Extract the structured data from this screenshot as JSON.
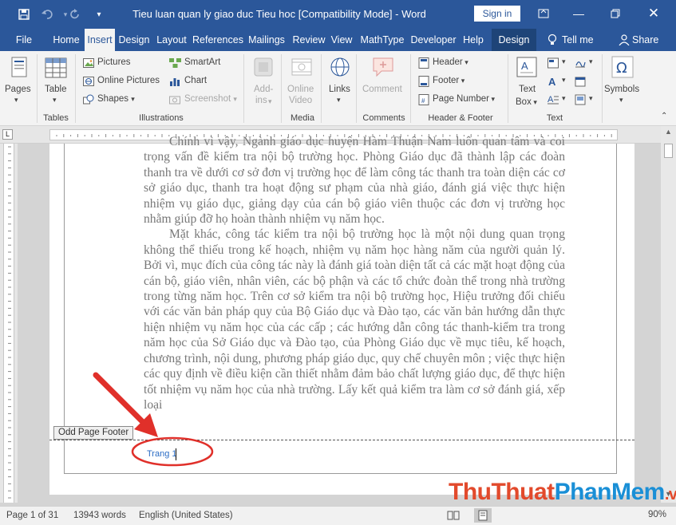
{
  "window": {
    "title": "Tieu luan quan ly giao duc Tieu hoc [Compatibility Mode]  -  Word",
    "signin_label": "Sign in"
  },
  "tabs": [
    "File",
    "Home",
    "Insert",
    "Design",
    "Layout",
    "References",
    "Mailings",
    "Review",
    "View",
    "MathType",
    "Developer",
    "Help",
    "Design"
  ],
  "tell_me": "Tell me",
  "share": "Share",
  "ribbon": {
    "pages": "Pages",
    "table": "Table",
    "pictures": "Pictures",
    "online_pictures": "Online Pictures",
    "shapes": "Shapes",
    "smartart": "SmartArt",
    "chart": "Chart",
    "screenshot": "Screenshot",
    "addins_1": "Add-",
    "addins_2": "ins",
    "online_video_1": "Online",
    "online_video_2": "Video",
    "links": "Links",
    "comment": "Comment",
    "header": "Header",
    "footer": "Footer",
    "page_number": "Page Number",
    "textbox_1": "Text",
    "textbox_2": "Box",
    "symbols": "Symbols",
    "groups": {
      "tables": "Tables",
      "illustrations": "Illustrations",
      "media": "Media",
      "comments": "Comments",
      "header_footer": "Header & Footer",
      "text": "Text"
    }
  },
  "document": {
    "paragraph1": "Chính vì vậy, Ngành giáo dục huyện Hàm Thuận Nam luôn quan tâm và coi trọng vấn đề kiểm tra nội bộ trường học. Phòng Giáo dục đã thành lập các đoàn thanh tra về dưới cơ sở đơn vị trường học để làm công tác thanh tra toàn diện các cơ sở giáo dục, thanh tra hoạt động sư phạm của nhà     giáo, đánh giá việc thực hiện nhiệm vụ giáo dục, giảng dạy của cán bộ giáo viên thuộc các đơn vị trường học nhằm giúp đỡ họ hoàn thành nhiệm vụ năm học.",
    "paragraph2": "Mặt khác, công tác kiểm tra nội bộ trường học là một nội dung quan trọng không thể thiếu trong kế hoạch, nhiệm vụ năm học hàng năm của người quản lý. Bởi vì, mục đích của công tác này là đánh giá toàn diện tất cả các mặt hoạt động của cán bộ, giáo viên, nhân viên, các bộ phận và các tổ chức đoàn thể trong nhà trường trong từng năm học. Trên cơ sở kiểm tra nội bộ trường học, Hiệu trưởng đối chiếu với các văn bản pháp quy của Bộ Giáo dục và Đào tạo, các văn bản hướng dẫn thực hiện nhiệm vụ năm học của các cấp ; các hướng dẫn công tác thanh-kiểm tra trong năm học của Sở Giáo dục và Đào tạo, của Phòng Giáo dục về mục tiêu, kế hoạch, chương trình, nội dung, phương pháp giáo dục, quy chế chuyên môn ; việc thực hiện các quy định về điều kiện cần thiết nhằm đảm bảo chất lượng giáo dục, để thực hiện tốt nhiệm vụ năm học của nhà trường. Lấy kết quả kiểm tra làm cơ sở đánh giá, xếp loại",
    "footer_label": "Odd Page Footer",
    "footer_text": "Trang 1"
  },
  "status": {
    "page": "Page 1 of 31",
    "words": "13943 words",
    "language": "English (United States)",
    "zoom": "90%"
  },
  "watermark": {
    "part1": "ThuThuat",
    "part2": "PhanMem",
    "part3": ".vn"
  },
  "colors": {
    "accent": "#2b579a",
    "annotation": "#e0302a"
  }
}
